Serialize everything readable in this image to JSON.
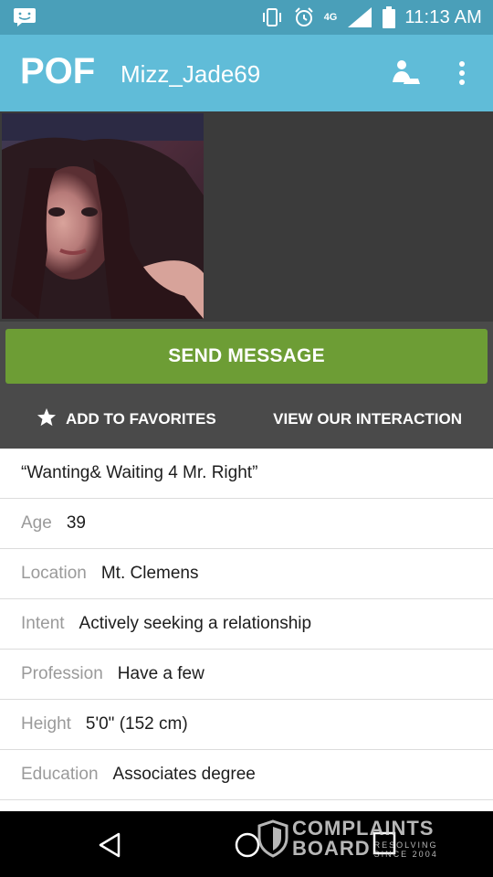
{
  "status_bar": {
    "time": "11:13 AM",
    "network": "4G",
    "icons": [
      "message-icon",
      "vibrate-icon",
      "alarm-icon",
      "signal-icon",
      "battery-icon"
    ]
  },
  "header": {
    "logo": "POF",
    "username": "Mizz_Jade69",
    "icons": [
      "user-match-icon",
      "more-vert-icon"
    ]
  },
  "actions": {
    "send_message": "SEND MESSAGE",
    "add_favorites": "ADD TO FAVORITES",
    "view_interaction": "VIEW OUR INTERACTION"
  },
  "profile": {
    "tagline": "“Wanting& Waiting 4 Mr. Right”",
    "fields": [
      {
        "label": "Age",
        "value": "39"
      },
      {
        "label": "Location",
        "value": "Mt. Clemens"
      },
      {
        "label": "Intent",
        "value": "Actively seeking a relationship"
      },
      {
        "label": "Profession",
        "value": "Have a few"
      },
      {
        "label": "Height",
        "value": "5'0\" (152 cm)"
      },
      {
        "label": "Education",
        "value": "Associates degree"
      }
    ]
  },
  "watermark": {
    "line1": "COMPLAINTS",
    "line2": "BOARD",
    "sub1": "RESOLVING",
    "sub2": "SINCE 2004"
  },
  "colors": {
    "status_bar": "#4a9fb9",
    "app_bar": "#60bcd8",
    "send_button": "#6d9d35",
    "actions_bg": "#4a4a4a",
    "photo_bg": "#3b3b3b"
  }
}
